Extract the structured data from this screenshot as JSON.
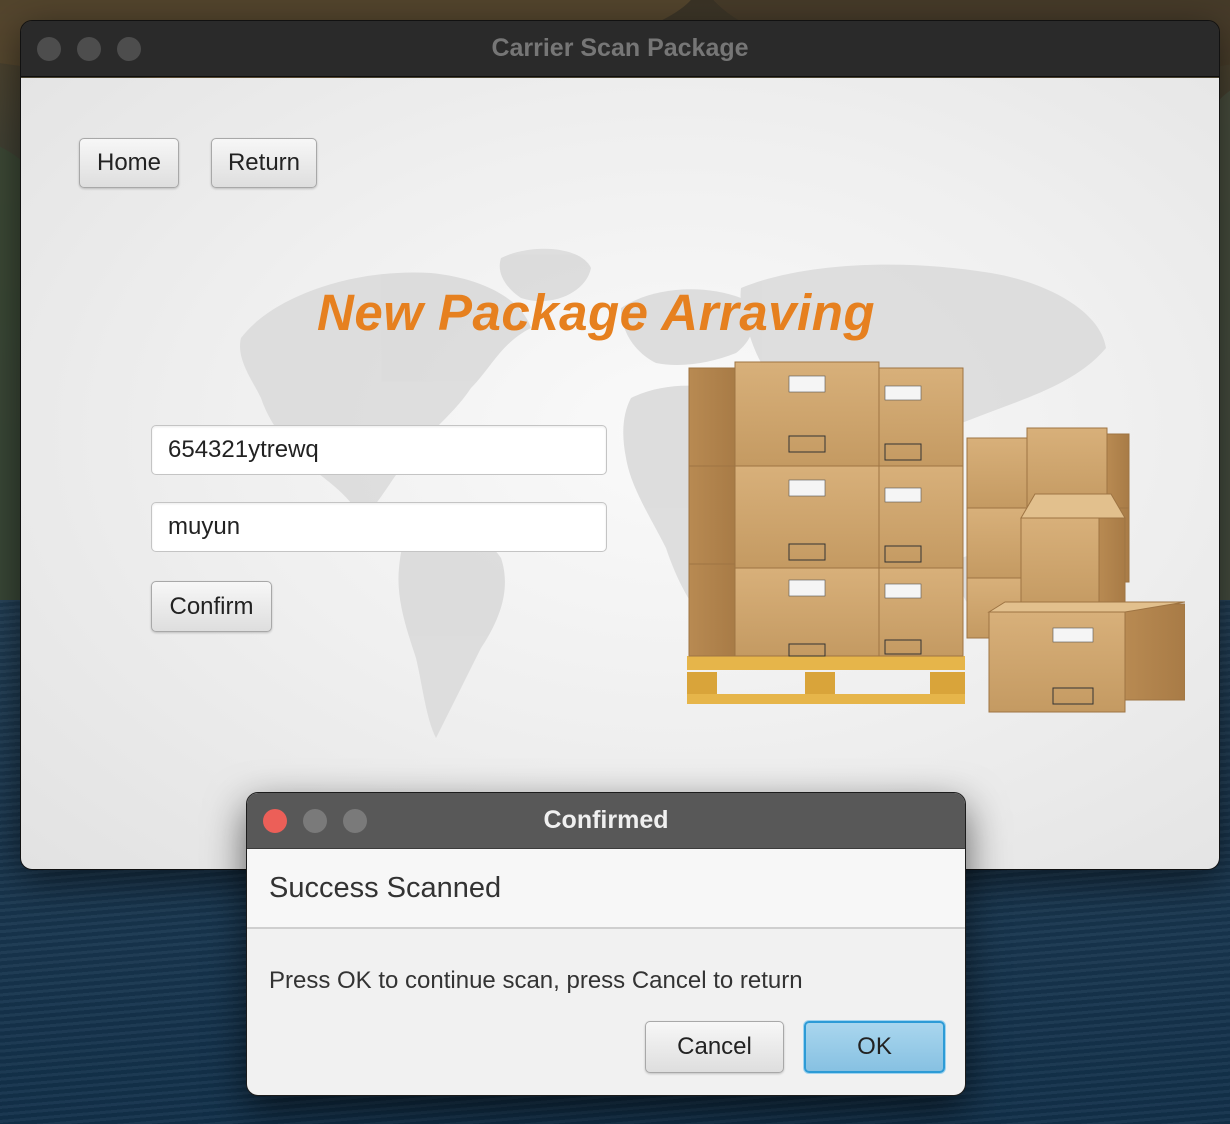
{
  "window": {
    "title": "Carrier Scan Package"
  },
  "nav": {
    "home_label": "Home",
    "return_label": "Return"
  },
  "headline": "New Package Arraving",
  "form": {
    "field1_value": "654321ytrewq",
    "field2_value": "muyun",
    "confirm_label": "Confirm"
  },
  "dialog": {
    "title": "Confirmed",
    "header": "Success Scanned",
    "message": "Press OK to continue scan, press Cancel to return",
    "cancel_label": "Cancel",
    "ok_label": "OK"
  },
  "colors": {
    "accent": "#e6801f",
    "ok_button": "#87c1e2",
    "close_dot": "#ec5f58"
  },
  "icons": [
    "world-map-graphic",
    "cardboard-boxes-pallet-graphic"
  ]
}
